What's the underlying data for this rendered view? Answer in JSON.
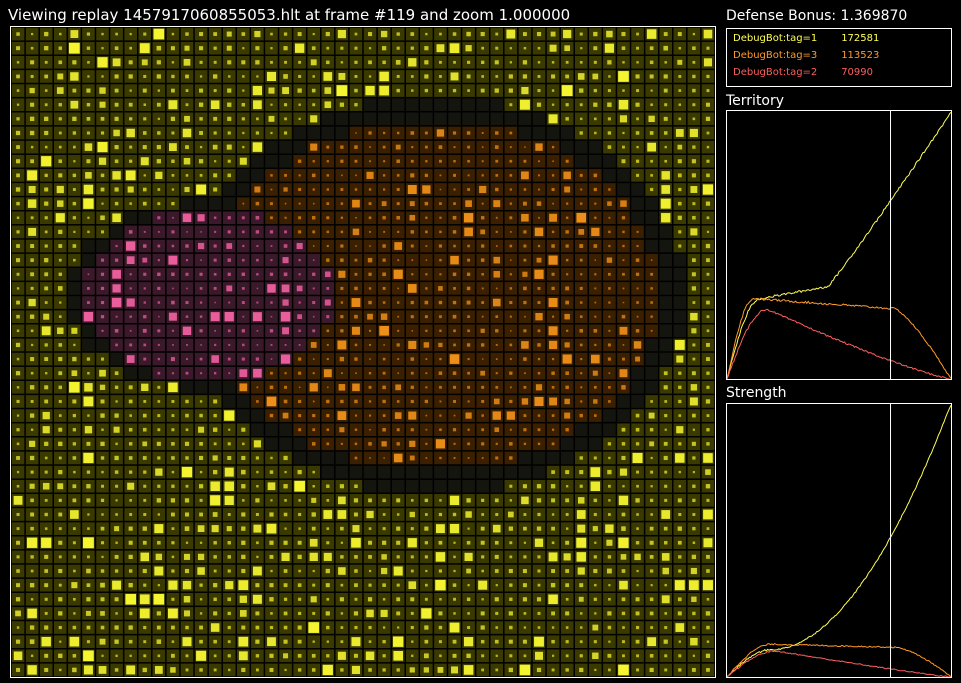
{
  "header": {
    "title": "Viewing replay 1457917060855053.hlt at frame #119 and zoom 1.000000"
  },
  "sidebar": {
    "defense_bonus": "Defense Bonus: 1.369870",
    "players": [
      {
        "name": "DebugBot:tag=1",
        "score": "172581",
        "color": "#ffff55"
      },
      {
        "name": "DebugBot:tag=3",
        "score": "113523",
        "color": "#ff9a2a"
      },
      {
        "name": "DebugBot:tag=2",
        "score": "70990",
        "color": "#ff5e5e"
      }
    ],
    "territory_label": "Territory",
    "strength_label": "Strength"
  },
  "colors": {
    "background": "#000000",
    "neutral_cell": "#333300",
    "player1_cell": "#3a3a00",
    "player2_cell": "#3a1a2a",
    "player3_cell": "#3a2000",
    "frontier_cell": "#151510",
    "line": "#ffffff"
  },
  "replay": {
    "frame": 119,
    "frame_fraction": 0.73,
    "grid_cols": 50,
    "grid_rows": 46
  }
}
